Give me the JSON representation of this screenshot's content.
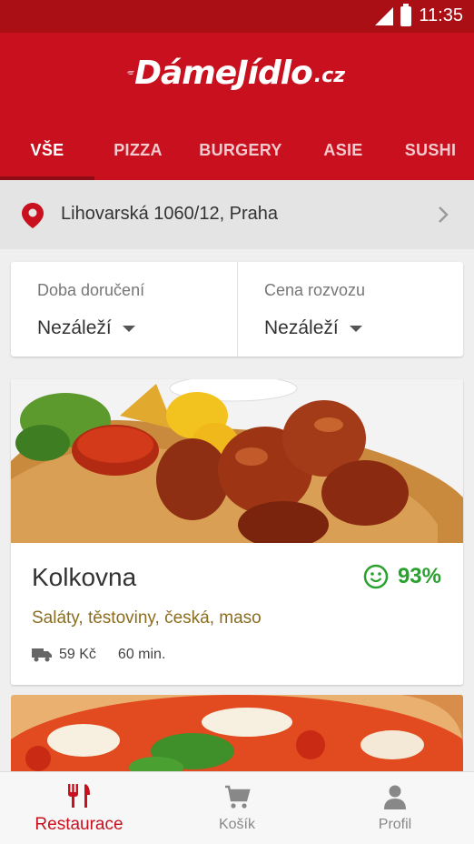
{
  "status_bar": {
    "time": "11:35"
  },
  "app": {
    "logo_word": "DámeJídlo",
    "logo_tld": ".cz",
    "brand_color": "#c8101f"
  },
  "tabs": [
    {
      "label": "VŠE",
      "active": true
    },
    {
      "label": "PIZZA"
    },
    {
      "label": "BURGERY"
    },
    {
      "label": "ASIE"
    },
    {
      "label": "SUSHI"
    }
  ],
  "address": {
    "text": "Lihovarská 1060/12, Praha",
    "icon": "location-pin-icon"
  },
  "filters": {
    "delivery_time": {
      "label": "Doba doručení",
      "value": "Nezáleží"
    },
    "delivery_price": {
      "label": "Cena rozvozu",
      "value": "Nezáleží"
    }
  },
  "restaurants": [
    {
      "name": "Kolkovna",
      "rating": "93%",
      "cuisine": "Saláty, těstoviny, česká, maso",
      "delivery_price": "59 Kč",
      "delivery_time": "60 min."
    }
  ],
  "bottom_nav": [
    {
      "label": "Restaurace",
      "icon": "fork-knife-icon",
      "active": true
    },
    {
      "label": "Košík",
      "icon": "cart-icon"
    },
    {
      "label": "Profil",
      "icon": "person-icon"
    }
  ]
}
